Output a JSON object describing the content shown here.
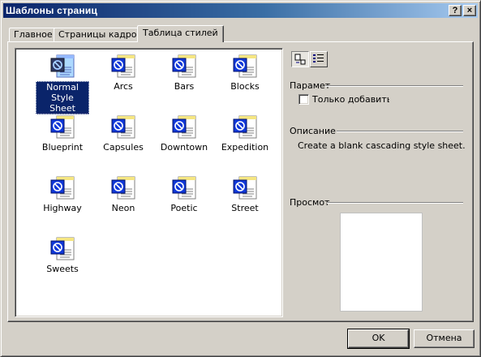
{
  "window": {
    "title": "Шаблоны страниц",
    "help_glyph": "?",
    "close_glyph": "×"
  },
  "tabs": [
    {
      "label": "Главное",
      "active": false
    },
    {
      "label": "Страницы кадров",
      "active": false
    },
    {
      "label": "Таблица стилей",
      "active": true
    }
  ],
  "templates": [
    {
      "label": "Normal Style Sheet",
      "selected": true,
      "icon": "style-sheet-document-icon"
    },
    {
      "label": "Arcs",
      "selected": false,
      "icon": "style-sheet-document-icon"
    },
    {
      "label": "Bars",
      "selected": false,
      "icon": "style-sheet-document-icon"
    },
    {
      "label": "Blocks",
      "selected": false,
      "icon": "style-sheet-document-icon"
    },
    {
      "label": "Blueprint",
      "selected": false,
      "icon": "style-sheet-document-icon"
    },
    {
      "label": "Capsules",
      "selected": false,
      "icon": "style-sheet-document-icon"
    },
    {
      "label": "Downtown",
      "selected": false,
      "icon": "style-sheet-document-icon"
    },
    {
      "label": "Expedition",
      "selected": false,
      "icon": "style-sheet-document-icon"
    },
    {
      "label": "Highway",
      "selected": false,
      "icon": "style-sheet-document-icon"
    },
    {
      "label": "Neon",
      "selected": false,
      "icon": "style-sheet-document-icon"
    },
    {
      "label": "Poetic",
      "selected": false,
      "icon": "style-sheet-document-icon"
    },
    {
      "label": "Street",
      "selected": false,
      "icon": "style-sheet-document-icon"
    },
    {
      "label": "Sweets",
      "selected": false,
      "icon": "style-sheet-document-icon"
    }
  ],
  "view_buttons": [
    {
      "icon": "large-icons-view-icon",
      "pressed": true
    },
    {
      "icon": "list-view-icon",
      "pressed": false
    }
  ],
  "options": {
    "heading": "Парамет",
    "checkbox_label": "Только добавить W",
    "checkbox_checked": false
  },
  "description": {
    "heading": "Описание",
    "text": "Create a blank cascading style sheet."
  },
  "preview": {
    "heading": "Просмот"
  },
  "buttons": {
    "ok": "OK",
    "cancel": "Отмена"
  },
  "colors": {
    "title_start": "#0a246a",
    "title_end": "#a6caf0",
    "selection": "#0a246a",
    "face": "#d4d0c8"
  }
}
